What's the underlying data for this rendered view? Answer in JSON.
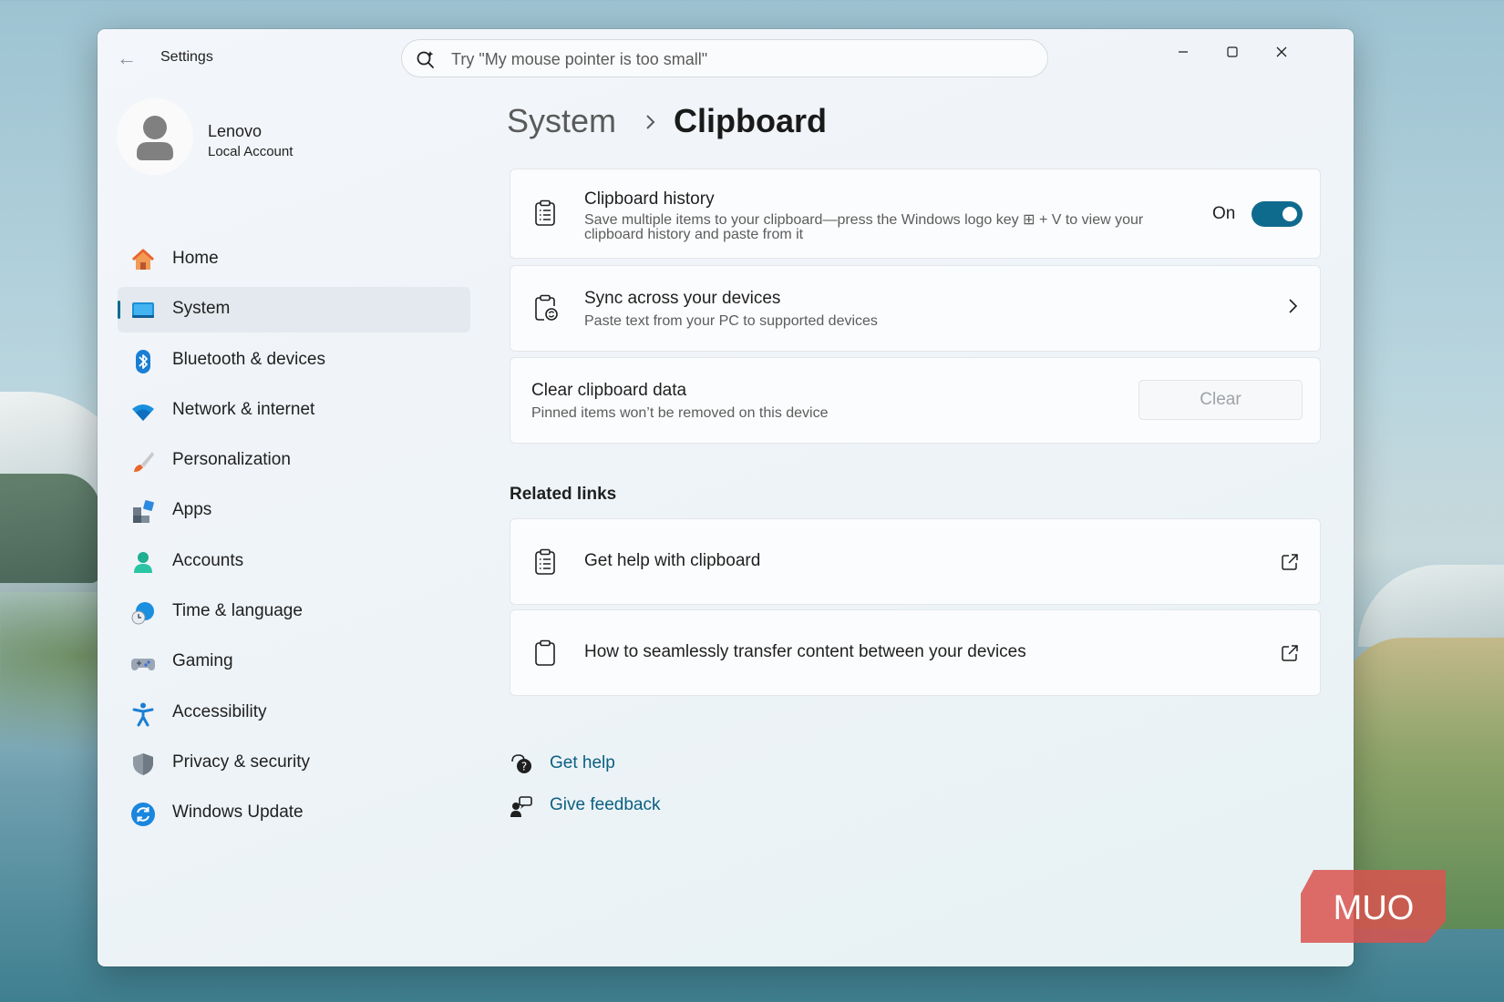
{
  "app": {
    "title": "Settings"
  },
  "search": {
    "placeholder": "Try \"My mouse pointer is too small\""
  },
  "profile": {
    "name": "Lenovo",
    "account_type": "Local Account"
  },
  "nav": {
    "items": [
      {
        "label": "Home",
        "icon": "home-icon"
      },
      {
        "label": "System",
        "icon": "system-icon",
        "selected": true
      },
      {
        "label": "Bluetooth & devices",
        "icon": "bluetooth-icon"
      },
      {
        "label": "Network & internet",
        "icon": "wifi-icon"
      },
      {
        "label": "Personalization",
        "icon": "brush-icon"
      },
      {
        "label": "Apps",
        "icon": "apps-icon"
      },
      {
        "label": "Accounts",
        "icon": "accounts-icon"
      },
      {
        "label": "Time & language",
        "icon": "time-language-icon"
      },
      {
        "label": "Gaming",
        "icon": "gaming-icon"
      },
      {
        "label": "Accessibility",
        "icon": "accessibility-icon"
      },
      {
        "label": "Privacy & security",
        "icon": "shield-icon"
      },
      {
        "label": "Windows Update",
        "icon": "windows-update-icon"
      }
    ]
  },
  "breadcrumb": {
    "parent": "System",
    "current": "Clipboard"
  },
  "settings": {
    "clipboard_history": {
      "title": "Clipboard history",
      "description": "Save multiple items to your clipboard—press the Windows logo key ⊞ + V to view your clipboard history and paste from it",
      "toggle_label": "On",
      "enabled": true
    },
    "sync": {
      "title": "Sync across your devices",
      "description": "Paste text from your PC to supported devices"
    },
    "clear": {
      "title": "Clear clipboard data",
      "description": "Pinned items won’t be removed on this device",
      "button_label": "Clear"
    }
  },
  "related_links": {
    "heading": "Related links",
    "items": [
      {
        "label": "Get help with clipboard"
      },
      {
        "label": "How to seamlessly transfer content between your devices"
      }
    ]
  },
  "footer": {
    "get_help": "Get help",
    "give_feedback": "Give feedback"
  },
  "watermark": {
    "text": "MUO"
  },
  "colors": {
    "accent": "#0f6b8d",
    "link": "#0a5f82",
    "watermark": "#d9534f"
  }
}
